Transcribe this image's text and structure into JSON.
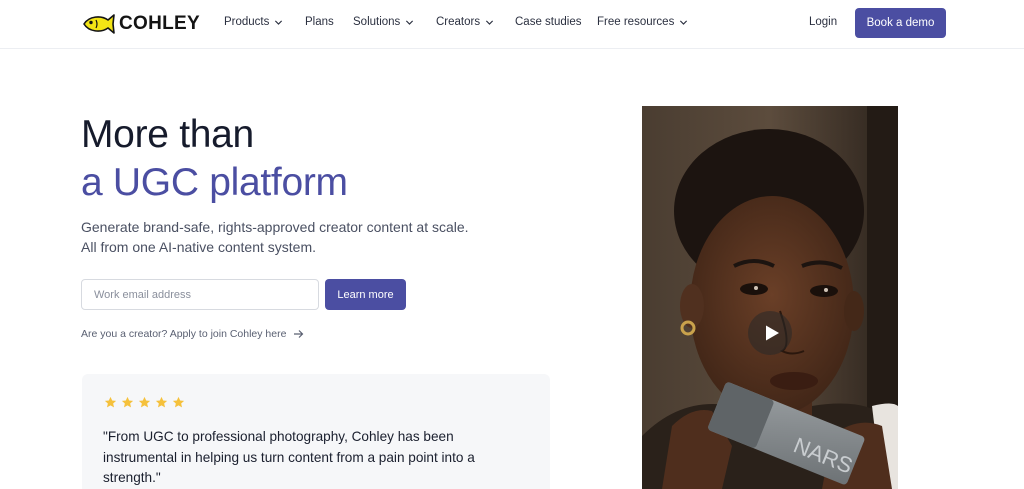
{
  "brand": {
    "name": "COHLEY",
    "logo_icon": "fish-icon",
    "accent": "#4b4ea2",
    "logo_color": "#f3e515"
  },
  "nav": {
    "items": [
      {
        "label": "Products",
        "dropdown": true
      },
      {
        "label": "Plans",
        "dropdown": false
      },
      {
        "label": "Solutions",
        "dropdown": true
      },
      {
        "label": "Creators",
        "dropdown": true
      },
      {
        "label": "Case studies",
        "dropdown": false
      },
      {
        "label": "Free resources",
        "dropdown": true
      }
    ],
    "login": "Login",
    "cta": "Book a demo"
  },
  "hero": {
    "title_line1": "More than",
    "title_line2": "a UGC platform",
    "subtitle_line1": "Generate brand-safe, rights-approved creator content at scale.",
    "subtitle_line2": "All from one AI-native content system.",
    "email_placeholder": "Work email address",
    "email_value": "",
    "learn_more": "Learn more",
    "creator_link": "Are you a creator? Apply to join Cohley here"
  },
  "testimonial": {
    "rating": 5,
    "star_color": "#f5c13c",
    "quote": "\"From UGC to professional photography, Cohley has been instrumental in helping us turn content from a pain point into a strength.\""
  },
  "video": {
    "play_icon": "play-icon",
    "product_text": "NARS"
  }
}
